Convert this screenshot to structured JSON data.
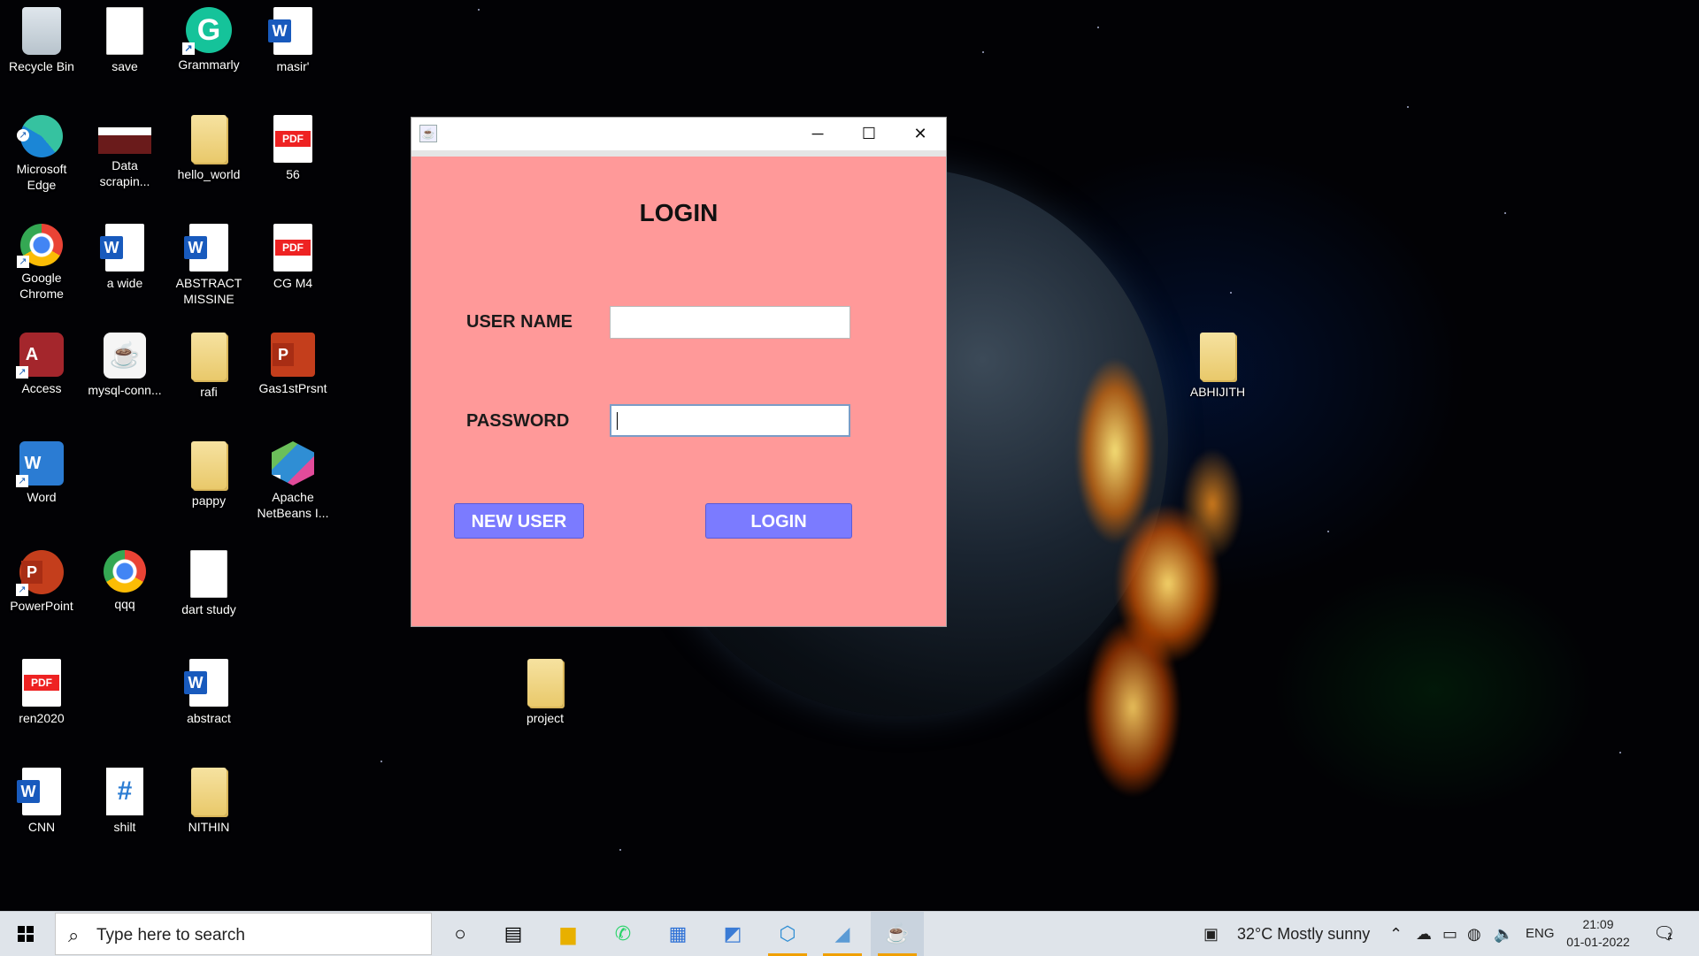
{
  "desktop": {
    "icons": [
      {
        "label": "Recycle Bin",
        "icon": "recycle-bin-icon"
      },
      {
        "label": "save",
        "icon": "text-file-icon"
      },
      {
        "label": "Grammarly",
        "icon": "grammarly-icon"
      },
      {
        "label": "masir'",
        "icon": "word-document-icon"
      },
      {
        "label": "Microsoft Edge",
        "icon": "edge-icon"
      },
      {
        "label": "Data scrapin...",
        "icon": "powerpoint-file-icon"
      },
      {
        "label": "hello_world",
        "icon": "folder-icon"
      },
      {
        "label": "56",
        "icon": "pdf-icon"
      },
      {
        "label": "Google Chrome",
        "icon": "chrome-icon"
      },
      {
        "label": "a wide",
        "icon": "word-document-icon"
      },
      {
        "label": "ABSTRACT MISSINE",
        "icon": "word-document-icon"
      },
      {
        "label": "CG M4",
        "icon": "pdf-icon"
      },
      {
        "label": "Access",
        "icon": "access-icon"
      },
      {
        "label": "mysql-conn...",
        "icon": "java-jar-icon"
      },
      {
        "label": "rafi",
        "icon": "folder-icon"
      },
      {
        "label": "Gas1stPrsnt",
        "icon": "powerpoint-file-icon"
      },
      {
        "label": "Word",
        "icon": "word-app-icon"
      },
      {
        "label": "pappy",
        "icon": "folder-icon"
      },
      {
        "label": "Apache NetBeans I...",
        "icon": "netbeans-icon"
      },
      {
        "label": "PowerPoint",
        "icon": "powerpoint-app-icon"
      },
      {
        "label": "qqq",
        "icon": "chrome-icon"
      },
      {
        "label": "dart study",
        "icon": "text-file-icon"
      },
      {
        "label": "ren2020",
        "icon": "pdf-icon"
      },
      {
        "label": "abstract",
        "icon": "word-document-icon"
      },
      {
        "label": "CNN",
        "icon": "word-document-icon"
      },
      {
        "label": "shilt",
        "icon": "csharp-file-icon"
      },
      {
        "label": "NITHIN",
        "icon": "folder-icon"
      },
      {
        "label": "project",
        "icon": "folder-icon"
      },
      {
        "label": "ABHIJITH",
        "icon": "folder-icon"
      }
    ]
  },
  "window": {
    "heading": "LOGIN",
    "username_label": "USER NAME",
    "username_value": "",
    "password_label": "PASSWORD",
    "password_value": "",
    "new_user_label": "NEW USER",
    "login_label": "LOGIN",
    "minimize": "─",
    "maximize": "☐",
    "close": "✕",
    "background_color": "#ff9999",
    "button_color": "#7b7bff"
  },
  "taskbar": {
    "search_placeholder": "Type here to search",
    "weather": "32°C  Mostly sunny",
    "language": "ENG",
    "time": "21:09",
    "date": "01-01-2022",
    "notification_count": "1"
  }
}
